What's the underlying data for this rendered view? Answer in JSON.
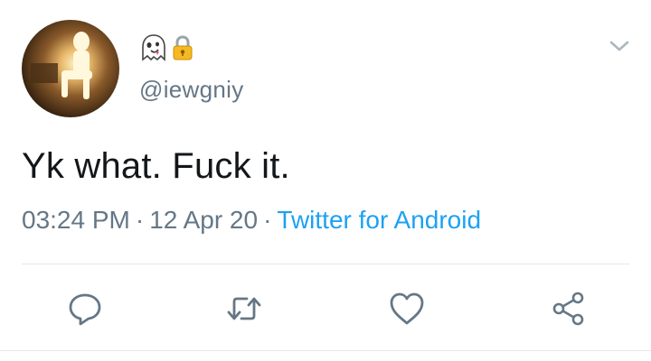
{
  "tweet": {
    "handle": "@iewgniy",
    "display_name_icons": [
      "ghost-emoji-icon",
      "locked-icon"
    ],
    "text": "Yk what. Fuck it.",
    "time": "03:24 PM",
    "separator": "·",
    "date": "12 Apr 20",
    "source": "Twitter for Android"
  },
  "actions": [
    "reply-icon",
    "retweet-icon",
    "like-icon",
    "share-icon"
  ],
  "colors": {
    "text": "#14171a",
    "muted": "#657786",
    "link": "#1da1f2",
    "divider": "#e1e8ed",
    "icon": "#657786"
  }
}
